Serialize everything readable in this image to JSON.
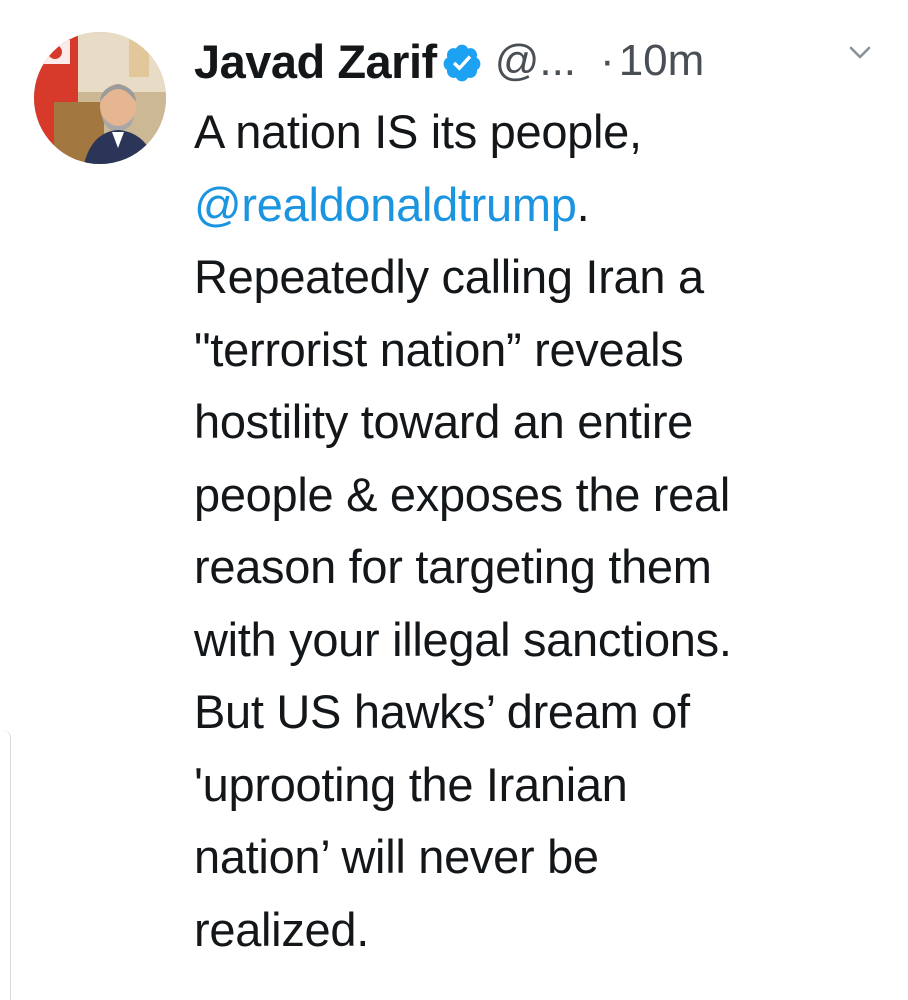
{
  "tweet": {
    "author_name": "Javad Zarif",
    "handle": "@...",
    "separator": "·",
    "time": "10m",
    "lines": [
      "A nation IS its people,",
      "@realdonaldtrump",
      ".",
      "Repeatedly calling Iran a",
      "\"terrorist nation” reveals",
      "hostility toward an entire",
      "people & exposes the real",
      "reason for targeting them",
      "with your illegal sanctions.",
      "But US hawks’ dream of",
      "'uprooting the Iranian",
      "nation’ will never be",
      "realized."
    ]
  },
  "icons": {
    "verified": "verified-badge-icon",
    "menu": "chevron-down-icon"
  },
  "colors": {
    "text": "#14171a",
    "secondary": "#4a4f55",
    "link": "#1b95e0",
    "verified": "#1da1f2"
  }
}
